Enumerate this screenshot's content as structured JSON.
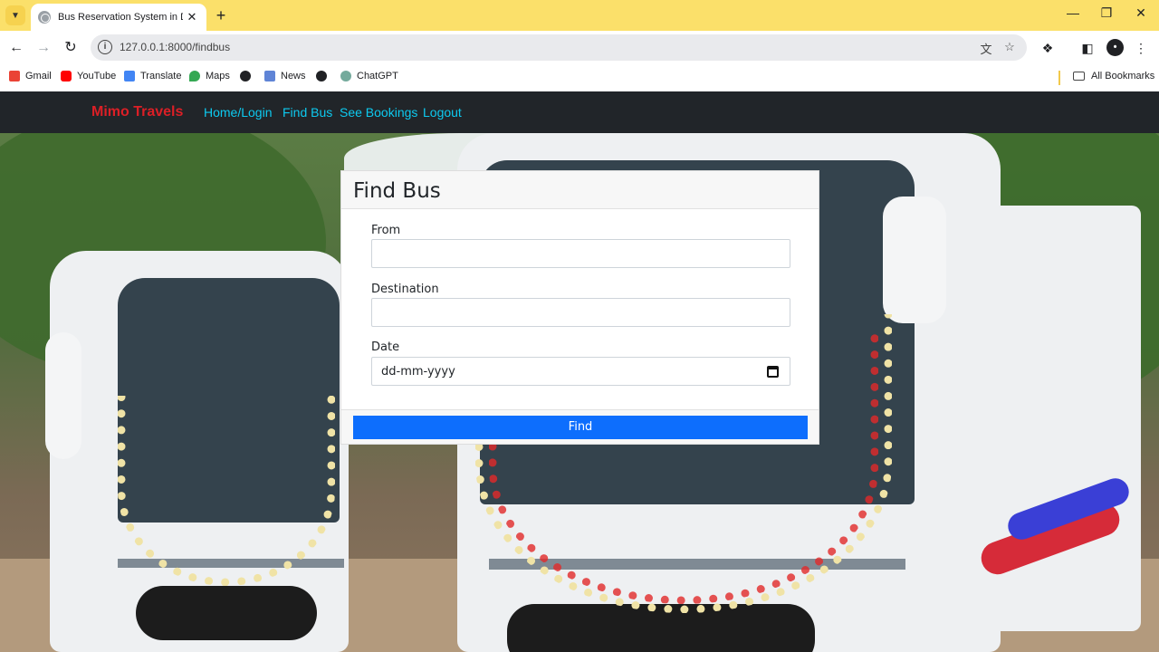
{
  "browser": {
    "tab_title": "Bus Reservation System in Djan",
    "url": "127.0.0.1:8000/findbus",
    "tab_bar_color": "#fbe06a",
    "icons": {
      "tab_menu": "chevron-down-icon",
      "close": "close-icon",
      "new_tab": "plus-icon",
      "back": "back-arrow-icon",
      "forward": "forward-arrow-icon",
      "reload": "reload-icon",
      "translate": "translate-icon",
      "bookmark": "star-icon",
      "extensions": "puzzle-icon",
      "side_panel": "side-panel-icon",
      "menu": "kebab-menu-icon"
    }
  },
  "bookmarks": [
    {
      "label": "Gmail",
      "icon": "gmail-icon"
    },
    {
      "label": "YouTube",
      "icon": "youtube-icon"
    },
    {
      "label": "Translate",
      "icon": "translate-icon"
    },
    {
      "label": "Maps",
      "icon": "maps-icon"
    },
    {
      "label": "",
      "icon": "globe-icon"
    },
    {
      "label": "News",
      "icon": "news-icon"
    },
    {
      "label": "",
      "icon": "globe-icon"
    },
    {
      "label": "ChatGPT",
      "icon": "chatgpt-icon"
    }
  ],
  "all_bookmarks": "All Bookmarks",
  "site": {
    "brand": "Mimo Travels",
    "brand_color": "#dc1f26",
    "link_color": "#0dcaf0",
    "nav": [
      "Home/Login",
      "Find Bus",
      "See Bookings",
      "Logout"
    ]
  },
  "form": {
    "title": "Find Bus",
    "from_label": "From",
    "from_value": "",
    "destination_label": "Destination",
    "destination_value": "",
    "date_label": "Date",
    "date_placeholder": "dd-mm-yyyy",
    "submit_label": "Find",
    "button_color": "#0d6efd"
  }
}
